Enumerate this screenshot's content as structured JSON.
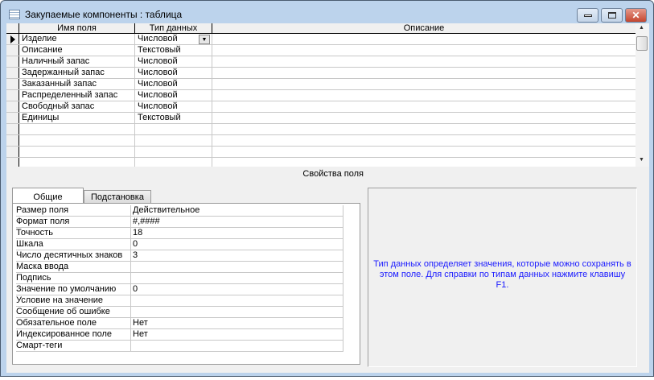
{
  "window": {
    "title": "Закупаемые компоненты : таблица",
    "min": "—",
    "max": "▭",
    "close": "✕"
  },
  "grid": {
    "headers": [
      "Имя поля",
      "Тип данных",
      "Описание"
    ],
    "rows": [
      {
        "name": "Изделие",
        "type": "Числовой",
        "description": ""
      },
      {
        "name": "Описание",
        "type": "Текстовый",
        "description": ""
      },
      {
        "name": "Наличный запас",
        "type": "Числовой",
        "description": ""
      },
      {
        "name": "Задержанный запас",
        "type": "Числовой",
        "description": ""
      },
      {
        "name": "Заказанный запас",
        "type": "Числовой",
        "description": ""
      },
      {
        "name": "Распределенный запас",
        "type": "Числовой",
        "description": ""
      },
      {
        "name": "Свободный запас",
        "type": "Числовой",
        "description": ""
      },
      {
        "name": "Единицы",
        "type": "Текстовый",
        "description": ""
      }
    ]
  },
  "properties": {
    "header": "Свойства поля",
    "tabs": [
      "Общие",
      "Подстановка"
    ],
    "rows": [
      {
        "label": "Размер поля",
        "value": "Действительное"
      },
      {
        "label": "Формат поля",
        "value": "#,####"
      },
      {
        "label": "Точность",
        "value": "18"
      },
      {
        "label": "Шкала",
        "value": "0"
      },
      {
        "label": "Число десятичных знаков",
        "value": "3"
      },
      {
        "label": "Маска ввода",
        "value": ""
      },
      {
        "label": "Подпись",
        "value": ""
      },
      {
        "label": "Значение по умолчанию",
        "value": "0"
      },
      {
        "label": "Условие на значение",
        "value": ""
      },
      {
        "label": "Сообщение об ошибке",
        "value": ""
      },
      {
        "label": "Обязательное поле",
        "value": "Нет"
      },
      {
        "label": "Индексированное поле",
        "value": "Нет"
      },
      {
        "label": "Смарт-теги",
        "value": ""
      }
    ]
  },
  "help": "Тип данных определяет значения, которые можно сохранять в этом поле.  Для справки по типам данных нажмите клавишу F1."
}
